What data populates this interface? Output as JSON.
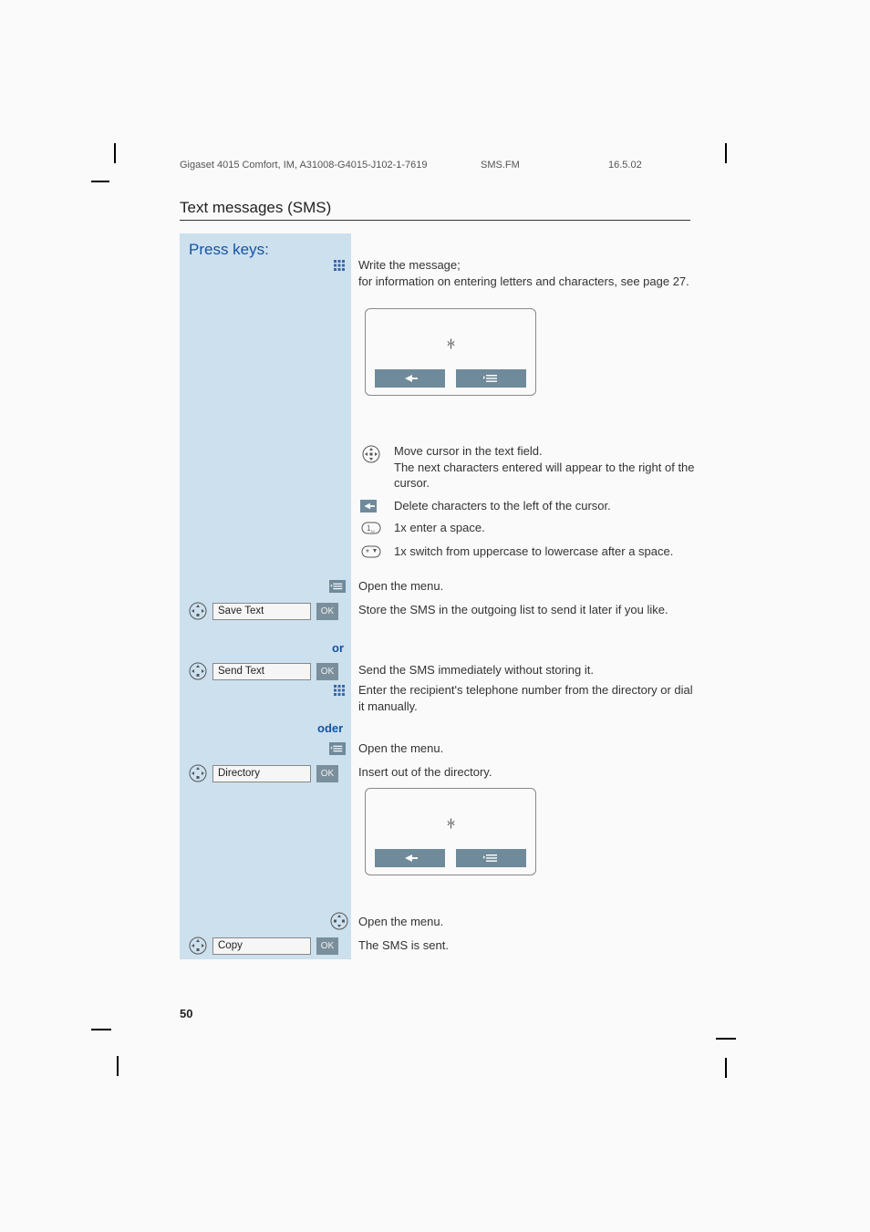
{
  "header": {
    "doc_id": "Gigaset 4015 Comfort, IM, A31008-G4015-J102-1-7619",
    "file": "SMS.FM",
    "date": "16.5.02"
  },
  "section_title": "Text messages (SMS)",
  "press_keys_label": "Press keys:",
  "steps": {
    "write_msg": {
      "line1": "Write the message;",
      "line2": "for information on entering letters and characters, see page 27."
    },
    "hints": {
      "nav": "Move cursor in the text field.\nThe next characters entered will appear to the right of the cursor.",
      "del": "Delete characters to the left of the cursor.",
      "space": "1x enter a space.",
      "case": "1x switch from uppercase to lowercase after a space."
    },
    "open_menu": "Open the menu.",
    "save_text_label": "Save Text",
    "save_text_desc": "Store the SMS in the outgoing list to send it later if you like.",
    "or": "or",
    "send_text_label": "Send Text",
    "send_text_desc": "Send the SMS immediately without storing it.",
    "enter_recipient": "Enter the recipient's telephone number from the directory or dial it manually.",
    "oder": "oder",
    "directory_label": "Directory",
    "directory_desc": "Insert out of the directory.",
    "copy_label": "Copy",
    "copy_desc": "The SMS is sent.",
    "ok": "OK"
  },
  "page_number": "50",
  "icons": {
    "keypad": "keypad-icon",
    "nav": "nav-icon",
    "back": "back-arrow-icon",
    "menu": "menu-icon",
    "one_key": "one-key-icon",
    "star_key": "star-key-icon",
    "cursor": "cursor-icon"
  }
}
